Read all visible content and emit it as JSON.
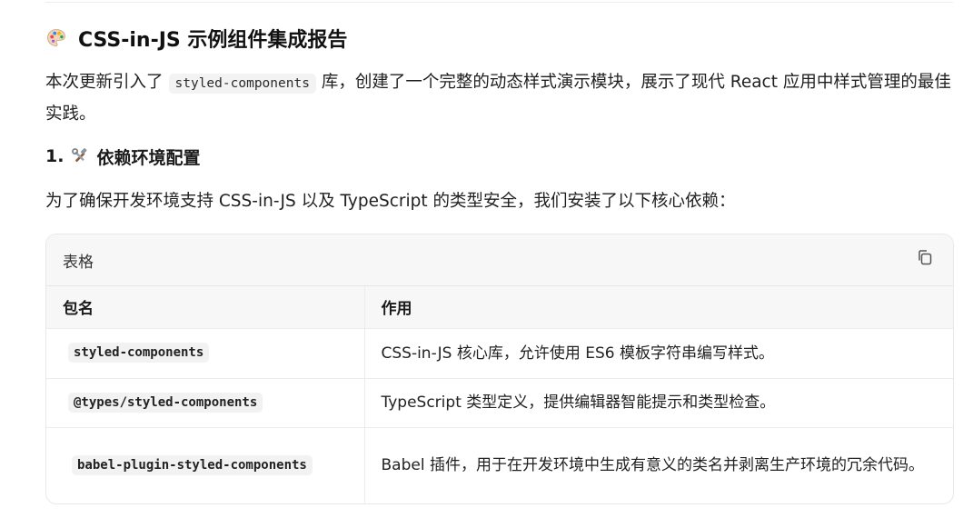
{
  "report": {
    "title": "CSS-in-JS 示例组件集成报告",
    "title_icon": "palette-icon",
    "intro_before": "本次更新引入了",
    "intro_code": "styled-components",
    "intro_after": "库，创建了一个完整的动态样式演示模块，展示了现代 React 应用中样式管理的最佳实践。",
    "section1": {
      "number": "1.",
      "icon": "hammer-wrench-icon",
      "heading": "依赖环境配置",
      "lead": "为了确保开发环境支持 CSS-in-JS 以及 TypeScript 的类型安全，我们安装了以下核心依赖："
    }
  },
  "table": {
    "label": "表格",
    "copy_icon": "copy-icon",
    "headers": [
      "包名",
      "作用"
    ],
    "rows": [
      {
        "package": "styled-components",
        "purpose": "CSS-in-JS 核心库，允许使用 ES6 模板字符串编写样式。"
      },
      {
        "package": "@types/styled-components",
        "purpose": "TypeScript 类型定义，提供编辑器智能提示和类型检查。"
      },
      {
        "package": "babel-plugin-styled-components",
        "purpose": "Babel 插件，用于在开发环境中生成有意义的类名并剥离生产环境的冗余代码。"
      }
    ]
  }
}
